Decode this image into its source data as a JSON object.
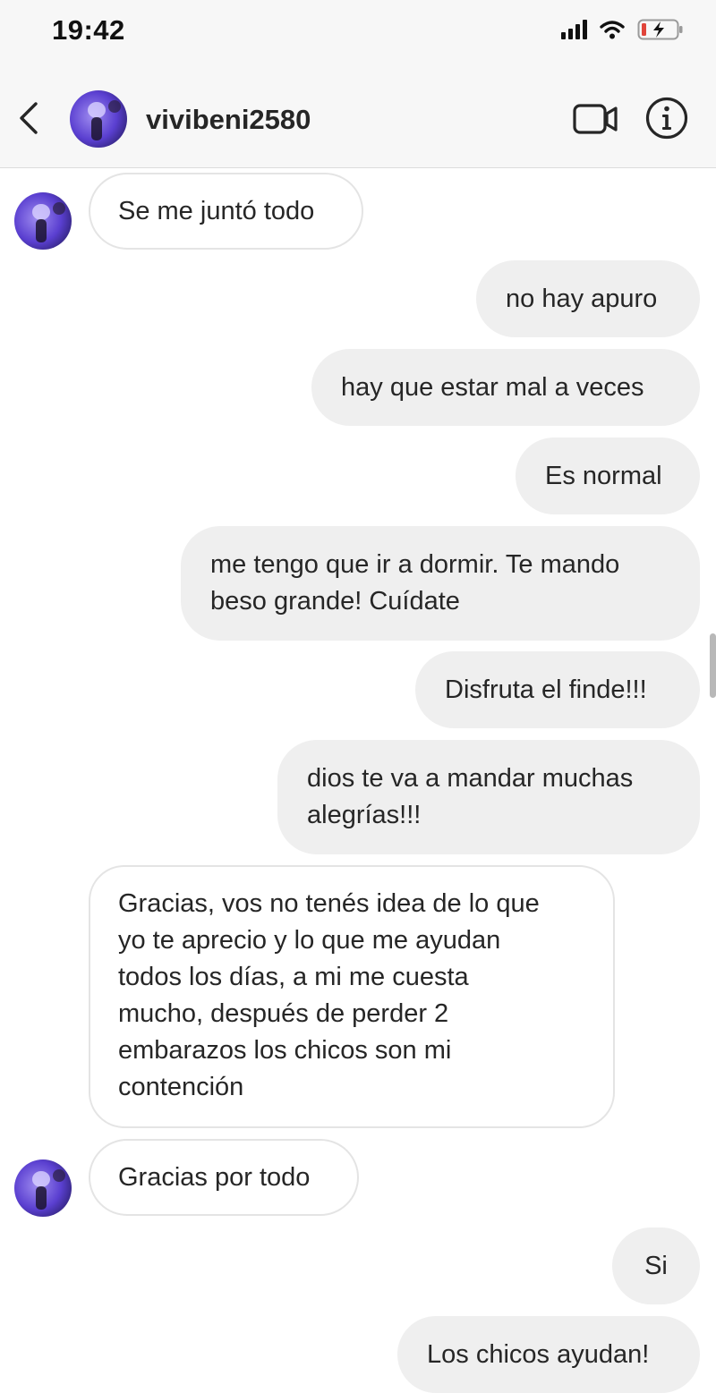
{
  "status_bar": {
    "time": "19:42"
  },
  "header": {
    "username": "vivibeni2580"
  },
  "messages": [
    {
      "text": "Se me juntó todo",
      "direction": "incoming"
    },
    {
      "text": "no hay apuro",
      "direction": "outgoing"
    },
    {
      "text": "hay que estar mal a veces",
      "direction": "outgoing"
    },
    {
      "text": "Es normal",
      "direction": "outgoing"
    },
    {
      "text": "me tengo que ir a dormir. Te mando\nbeso grande! Cuídate",
      "direction": "outgoing"
    },
    {
      "text": "Disfruta el finde!!!",
      "direction": "outgoing"
    },
    {
      "text": "dios te va a mandar muchas\nalegrías!!!",
      "direction": "outgoing"
    },
    {
      "text": "Gracias, vos no tenés idea de lo que\nyo te aprecio y lo que me ayudan\ntodos los días, a mi me cuesta\nmucho, después de perder 2\nembarazos los chicos son mi\ncontención",
      "direction": "incoming"
    },
    {
      "text": "Gracias por todo",
      "direction": "incoming"
    },
    {
      "text": "Si",
      "direction": "outgoing"
    },
    {
      "text": "Los chicos ayudan!",
      "direction": "outgoing"
    }
  ],
  "icons": {
    "back": "chevron-left-icon",
    "video": "video-camera-icon",
    "info": "info-icon",
    "signal": "signal-icon",
    "wifi": "wifi-icon",
    "battery": "battery-charging-icon"
  },
  "colors": {
    "outgoing_bubble": "#efefef",
    "incoming_bubble_border": "#e4e4e4",
    "battery_low": "#e0443a",
    "avatar_accent": "#6a4fd8"
  }
}
